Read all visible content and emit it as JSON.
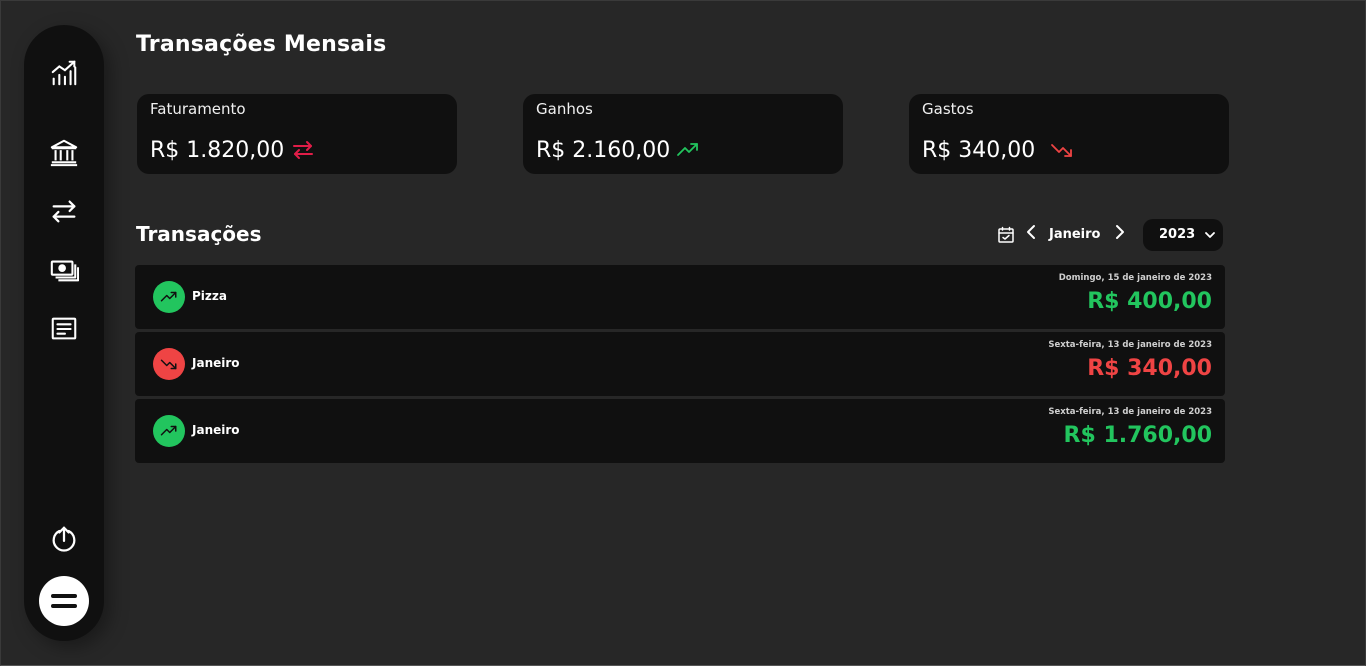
{
  "sidebar": {
    "icons": [
      "chart-icon",
      "bank-icon",
      "transfer-icon",
      "cash-icon",
      "receipt-icon",
      "logout-icon",
      "menu-icon"
    ]
  },
  "header": {
    "title": "Transações Mensais"
  },
  "summary": {
    "cards": [
      {
        "label": "Faturamento",
        "value": "R$ 1.820,00",
        "icon": "transfer-arrows-icon",
        "color": "#e11d48"
      },
      {
        "label": "Ganhos",
        "value": "R$ 2.160,00",
        "icon": "trend-up-icon",
        "color": "#22c55e"
      },
      {
        "label": "Gastos",
        "value": "R$ 340,00",
        "icon": "trend-down-icon",
        "color": "#ef4444"
      }
    ]
  },
  "transactions": {
    "title": "Transações",
    "month": "Janeiro",
    "year": "2023",
    "items": [
      {
        "name": "Pizza",
        "date": "Domingo, 15 de janeiro de 2023",
        "amount": "R$ 400,00",
        "type": "income",
        "color": "#22c55e"
      },
      {
        "name": "Janeiro",
        "date": "Sexta-feira, 13 de janeiro de 2023",
        "amount": "R$ 340,00",
        "type": "expense",
        "color": "#ef4444"
      },
      {
        "name": "Janeiro",
        "date": "Sexta-feira, 13 de janeiro de 2023",
        "amount": "R$ 1.760,00",
        "type": "income",
        "color": "#22c55e"
      }
    ]
  }
}
